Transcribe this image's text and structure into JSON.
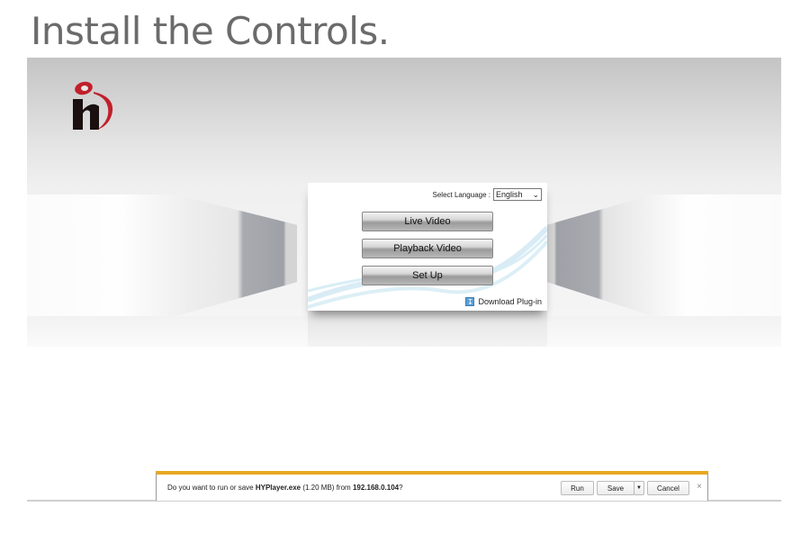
{
  "slide": {
    "title": "Install the Controls."
  },
  "login_panel": {
    "language_label": "Select Language :",
    "language_value": "English",
    "buttons": [
      "Live Video",
      "Playback Video",
      "Set Up"
    ],
    "download_plugin": "Download Plug-in"
  },
  "download_bar": {
    "prefix": "Do you want to run or save",
    "filename": "HYPlayer.exe",
    "size": "(1.20 MB)",
    "from": "from",
    "host": "192.168.0.104",
    "suffix": "?",
    "run": "Run",
    "save": "Save",
    "cancel": "Cancel",
    "close": "×",
    "accent": "#e8a820"
  },
  "icons": {
    "logo": "brand-logo",
    "select": "chevron-down-icon",
    "download": "download-icon",
    "close": "close-icon"
  }
}
